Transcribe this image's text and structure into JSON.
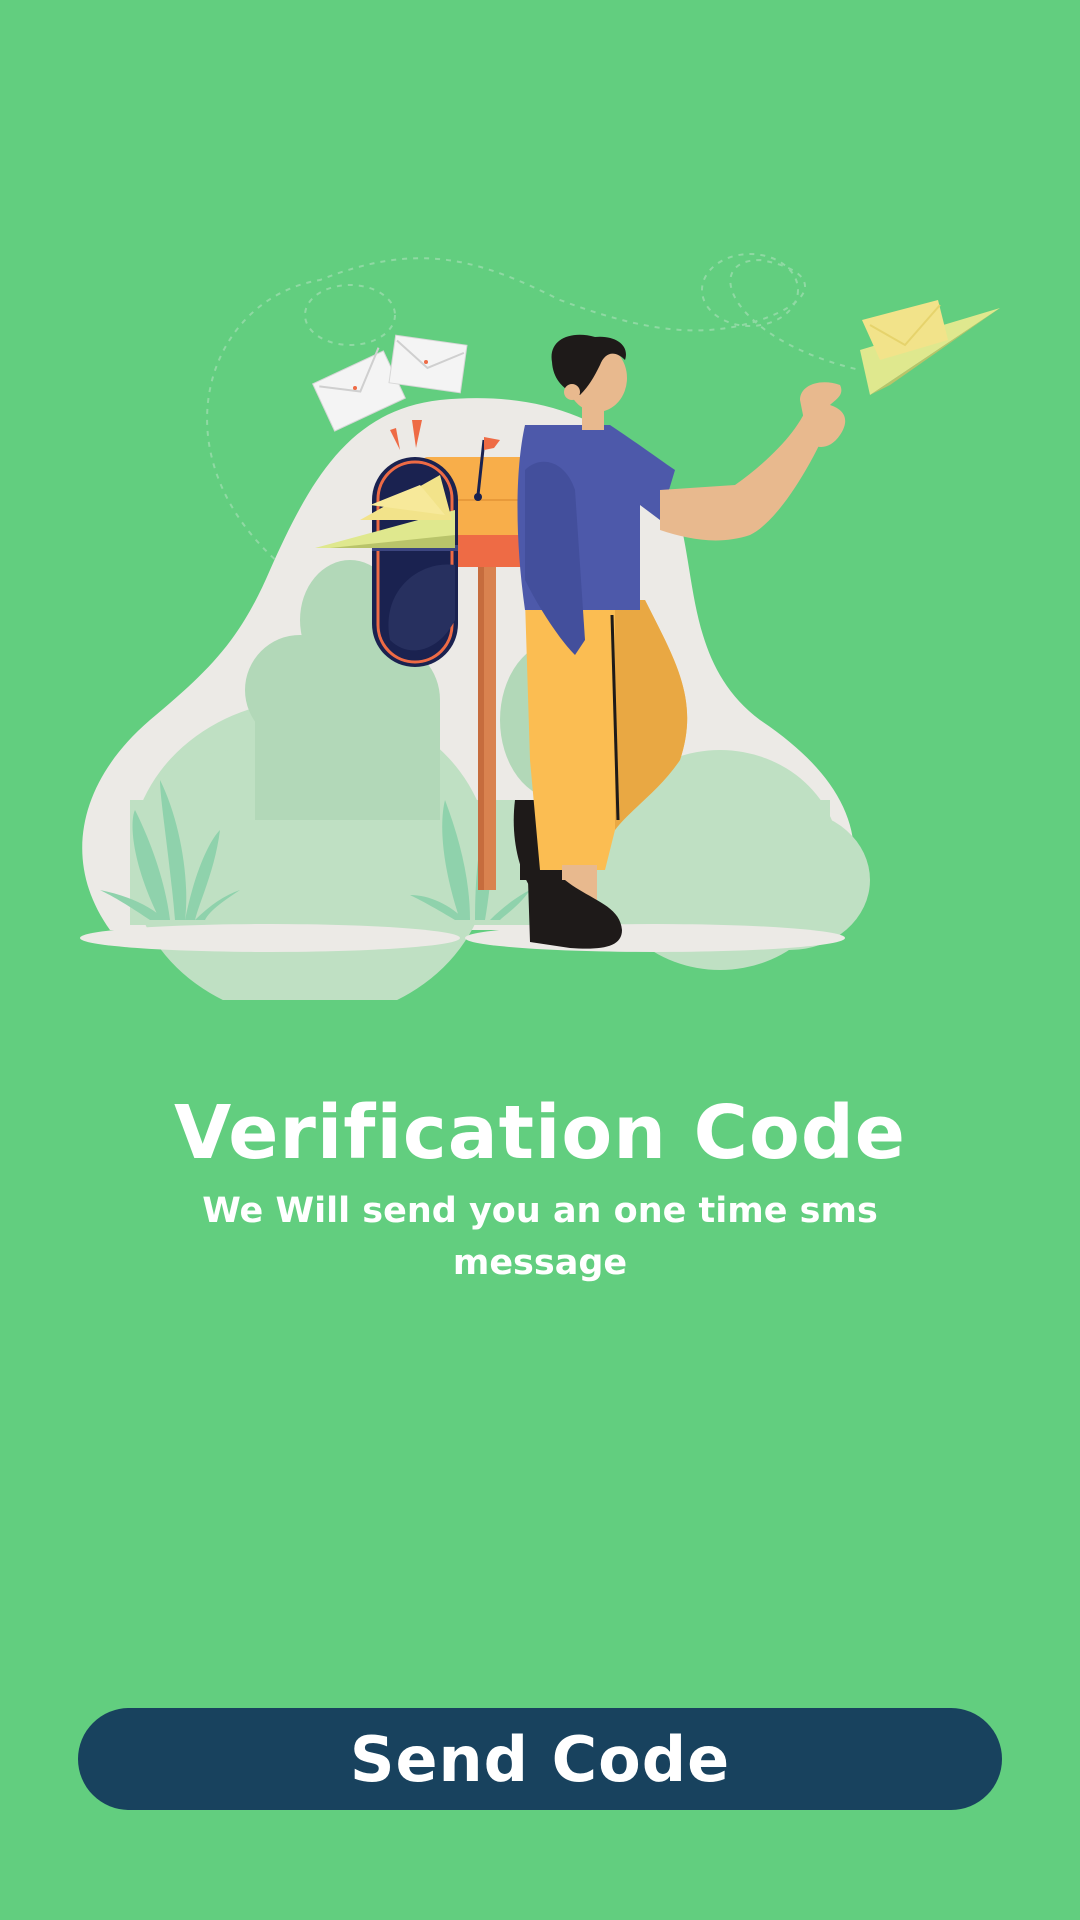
{
  "screen": {
    "background_color": "#62ce7f"
  },
  "illustration": {
    "icon": "mailbox-person-paper-plane-illustration"
  },
  "heading": {
    "title": "Verification Code",
    "subtitle": "We Will send you an  one time sms message"
  },
  "actions": {
    "send_code_label": "Send Code",
    "button_color": "#18425e"
  }
}
